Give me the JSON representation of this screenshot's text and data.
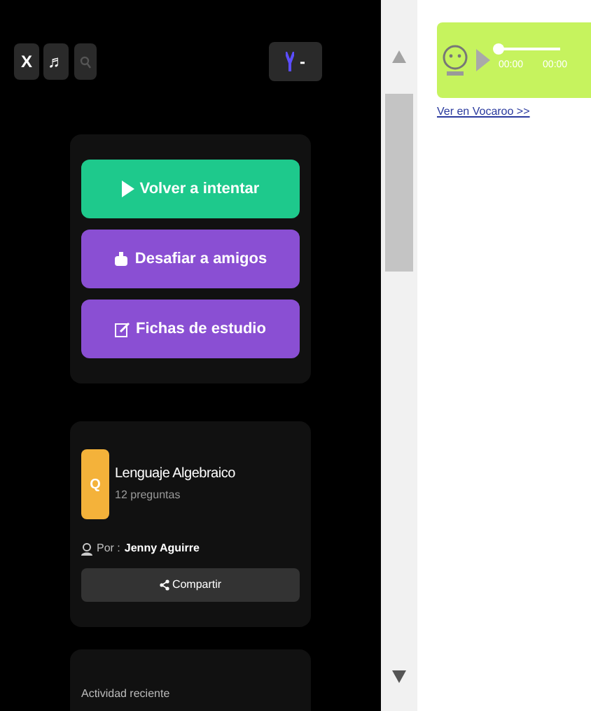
{
  "toolbar": {
    "close": "X",
    "music": "♬",
    "level_minus": "-"
  },
  "actions": [
    {
      "kind": "retry",
      "label": "Volver a intentar"
    },
    {
      "kind": "challenge",
      "label": "Desafiar a amigos"
    },
    {
      "kind": "cards",
      "label": "Fichas de estudio"
    }
  ],
  "quiz": {
    "logo": "Q",
    "title": "Lenguaje Algebraico",
    "count": "12 preguntas",
    "by_label": "Por :",
    "author": "Jenny Aguirre",
    "share": "Compartir"
  },
  "activity": {
    "title": "Actividad reciente"
  },
  "player": {
    "current": "00:00",
    "total": "00:00",
    "level": 0.0,
    "link": "Ver en Vocaroo >>"
  }
}
